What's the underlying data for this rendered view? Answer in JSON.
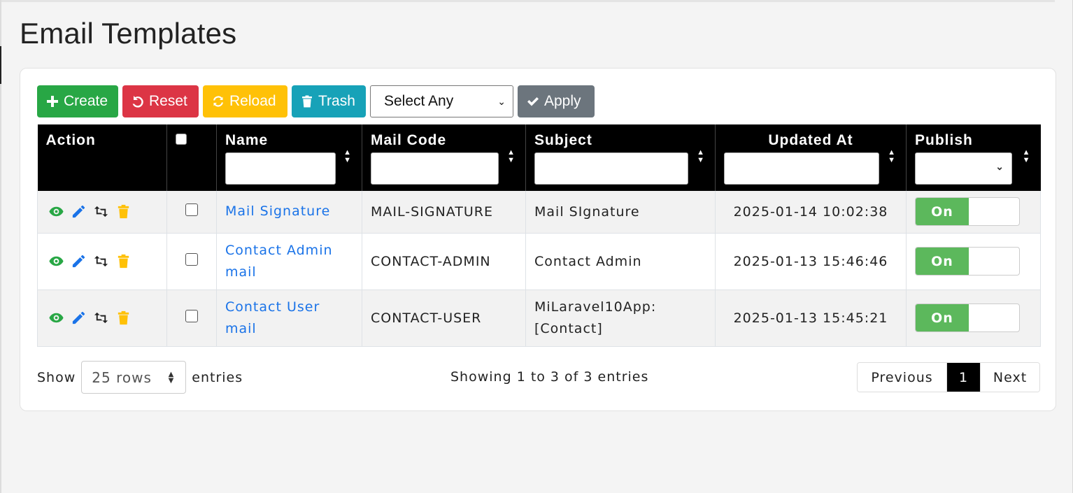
{
  "page": {
    "title": "Email Templates"
  },
  "toolbar": {
    "create_label": "Create",
    "reset_label": "Reset",
    "reload_label": "Reload",
    "trash_label": "Trash",
    "select_value": "Select Any",
    "apply_label": "Apply"
  },
  "table": {
    "headers": {
      "action": "Action",
      "name": "Name",
      "mail_code": "Mail Code",
      "subject": "Subject",
      "updated_at": "Updated At",
      "publish": "Publish"
    },
    "rows": [
      {
        "name": "Mail Signature",
        "mail_code": "MAIL-SIGNATURE",
        "subject": "Mail SIgnature",
        "updated_at": "2025-01-14 10:02:38",
        "publish": "On"
      },
      {
        "name": "Contact Admin mail",
        "mail_code": "CONTACT-ADMIN",
        "subject": "Contact Admin",
        "updated_at": "2025-01-13 15:46:46",
        "publish": "On"
      },
      {
        "name": "Contact User mail",
        "mail_code": "CONTACT-USER",
        "subject": "MiLaravel10App: [Contact]",
        "updated_at": "2025-01-13 15:45:21",
        "publish": "On"
      }
    ]
  },
  "footer": {
    "show_label": "Show",
    "rows_value": "25 rows",
    "entries_label": "entries",
    "info": "Showing 1 to 3 of 3 entries",
    "prev_label": "Previous",
    "current_page": "1",
    "next_label": "Next"
  },
  "colors": {
    "create": "#28a745",
    "reset": "#dc3545",
    "reload": "#ffc107",
    "trash": "#17a2b8",
    "apply": "#6c757d",
    "view_icon": "#28a745",
    "edit_icon": "#1a73e8",
    "delete_icon": "#ffc107",
    "toggle_on": "#5cb85c"
  },
  "icons": [
    "plus-icon",
    "undo-icon",
    "refresh-icon",
    "trash-icon",
    "check-icon",
    "eye-icon",
    "pencil-icon",
    "retweet-icon",
    "delete-icon"
  ]
}
